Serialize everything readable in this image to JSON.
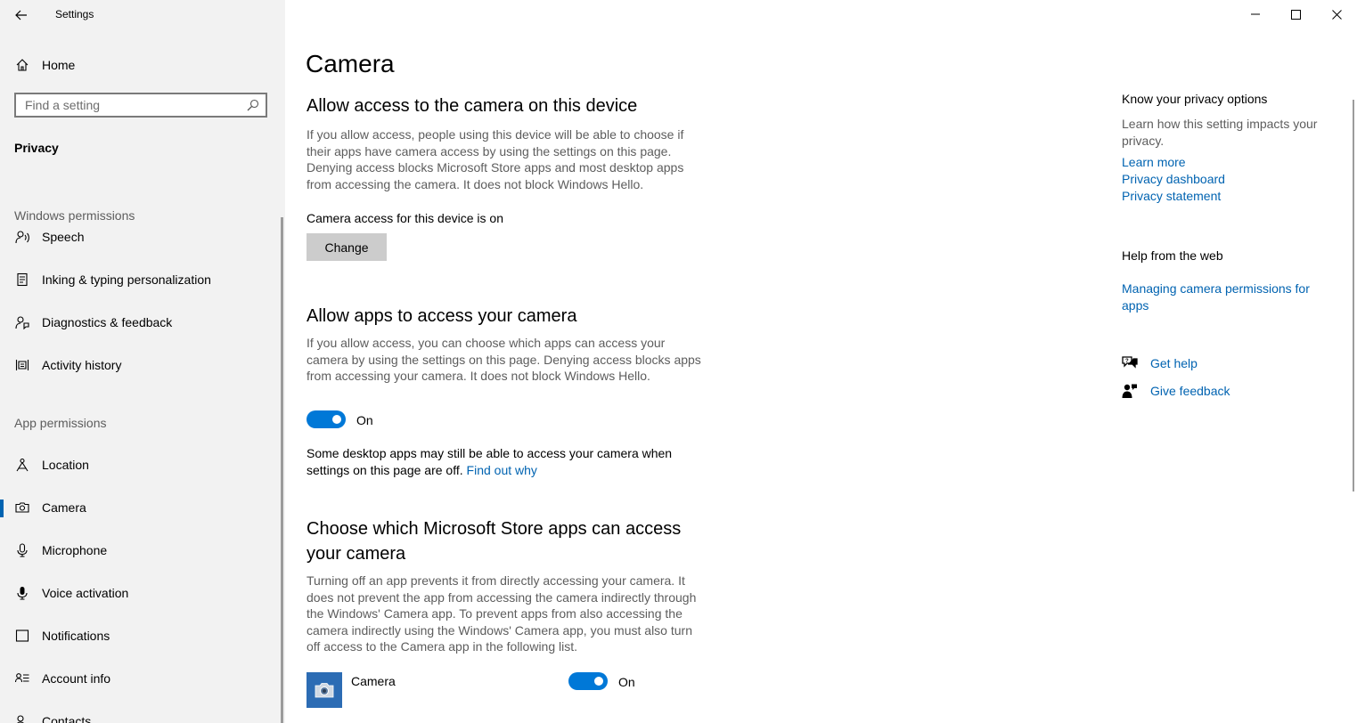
{
  "window": {
    "title": "Settings"
  },
  "sidebar": {
    "home_label": "Home",
    "search_placeholder": "Find a setting",
    "section_title": "Privacy",
    "windows_permissions_label": "Windows permissions",
    "windows_items": [
      {
        "label": "Speech",
        "icon": "speech-icon"
      },
      {
        "label": "Inking & typing personalization",
        "icon": "inking-icon"
      },
      {
        "label": "Diagnostics & feedback",
        "icon": "diagnostics-icon"
      },
      {
        "label": "Activity history",
        "icon": "activity-history-icon"
      }
    ],
    "app_permissions_label": "App permissions",
    "app_items": [
      {
        "label": "Location",
        "icon": "location-icon"
      },
      {
        "label": "Camera",
        "icon": "camera-icon",
        "selected": true
      },
      {
        "label": "Microphone",
        "icon": "microphone-icon"
      },
      {
        "label": "Voice activation",
        "icon": "voice-activation-icon"
      },
      {
        "label": "Notifications",
        "icon": "notifications-icon"
      },
      {
        "label": "Account info",
        "icon": "account-info-icon"
      },
      {
        "label": "Contacts",
        "icon": "contacts-icon"
      }
    ]
  },
  "main": {
    "page_title": "Camera",
    "device_section": {
      "heading": "Allow access to the camera on this device",
      "description": "If you allow access, people using this device will be able to choose if their apps have camera access by using the settings on this page. Denying access blocks Microsoft Store apps and most desktop apps from accessing the camera. It does not block Windows Hello.",
      "status": "Camera access for this device is on",
      "button_label": "Change"
    },
    "apps_section": {
      "heading": "Allow apps to access your camera",
      "description": "If you allow access, you can choose which apps can access your camera by using the settings on this page. Denying access blocks apps from accessing your camera. It does not block Windows Hello.",
      "toggle_state": "On",
      "note_prefix": "Some desktop apps may still be able to access your camera when settings on this page are off. ",
      "note_link": "Find out why"
    },
    "store_section": {
      "heading": "Choose which Microsoft Store apps can access your camera",
      "description": "Turning off an app prevents it from directly accessing your camera. It does not prevent the app from accessing the camera indirectly through the Windows' Camera app. To prevent apps from also accessing the camera indirectly using the Windows' Camera app, you must also turn off access to the Camera app in the following list.",
      "apps": [
        {
          "name": "Camera",
          "state": "On"
        }
      ]
    }
  },
  "right_column": {
    "privacy_heading": "Know your privacy options",
    "privacy_desc": "Learn how this setting impacts your privacy.",
    "privacy_links": [
      "Learn more",
      "Privacy dashboard",
      "Privacy statement"
    ],
    "help_heading": "Help from the web",
    "help_link": "Managing camera permissions for apps",
    "get_help": "Get help",
    "give_feedback": "Give feedback"
  },
  "colors": {
    "accent": "#0078d7",
    "link": "#0063b1",
    "sidebar_bg": "#f2f2f2"
  }
}
